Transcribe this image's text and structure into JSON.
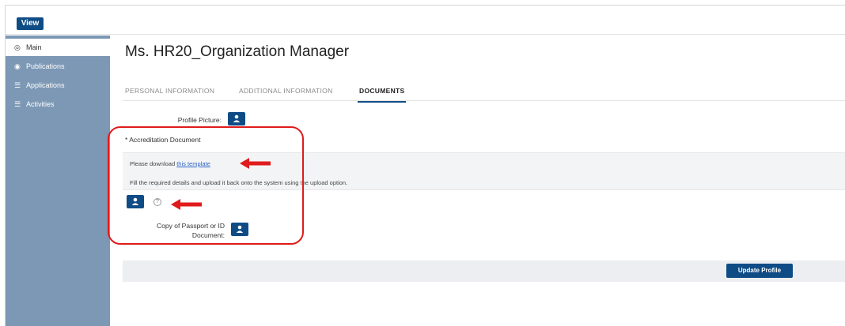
{
  "header": {
    "view_label": "View"
  },
  "sidebar": {
    "items": [
      {
        "label": "Main",
        "icon": "target-icon"
      },
      {
        "label": "Publications",
        "icon": "eye-icon"
      },
      {
        "label": "Applications",
        "icon": "list-icon"
      },
      {
        "label": "Activities",
        "icon": "list-icon"
      }
    ]
  },
  "main": {
    "title": "Ms. HR20_Organization Manager",
    "tabs": [
      {
        "label": "PERSONAL INFORMATION"
      },
      {
        "label": "ADDITIONAL INFORMATION"
      },
      {
        "label": "DOCUMENTS"
      }
    ],
    "active_tab": "DOCUMENTS",
    "profile_picture_label": "Profile Picture:",
    "accreditation_title": "* Accreditation Document",
    "download_prefix": "Please download ",
    "download_link": "this template",
    "instructions": "Fill the required details and upload it back onto the system using the upload option.",
    "help_glyph": "?",
    "passport_label_line1": "Copy of Passport or ID",
    "passport_label_line2": "Document:",
    "update_button": "Update Profile"
  },
  "colors": {
    "primary": "#0f4c86",
    "sidebar": "#7c98b5",
    "annotation": "#e01b1b",
    "link": "#2b66c4"
  }
}
